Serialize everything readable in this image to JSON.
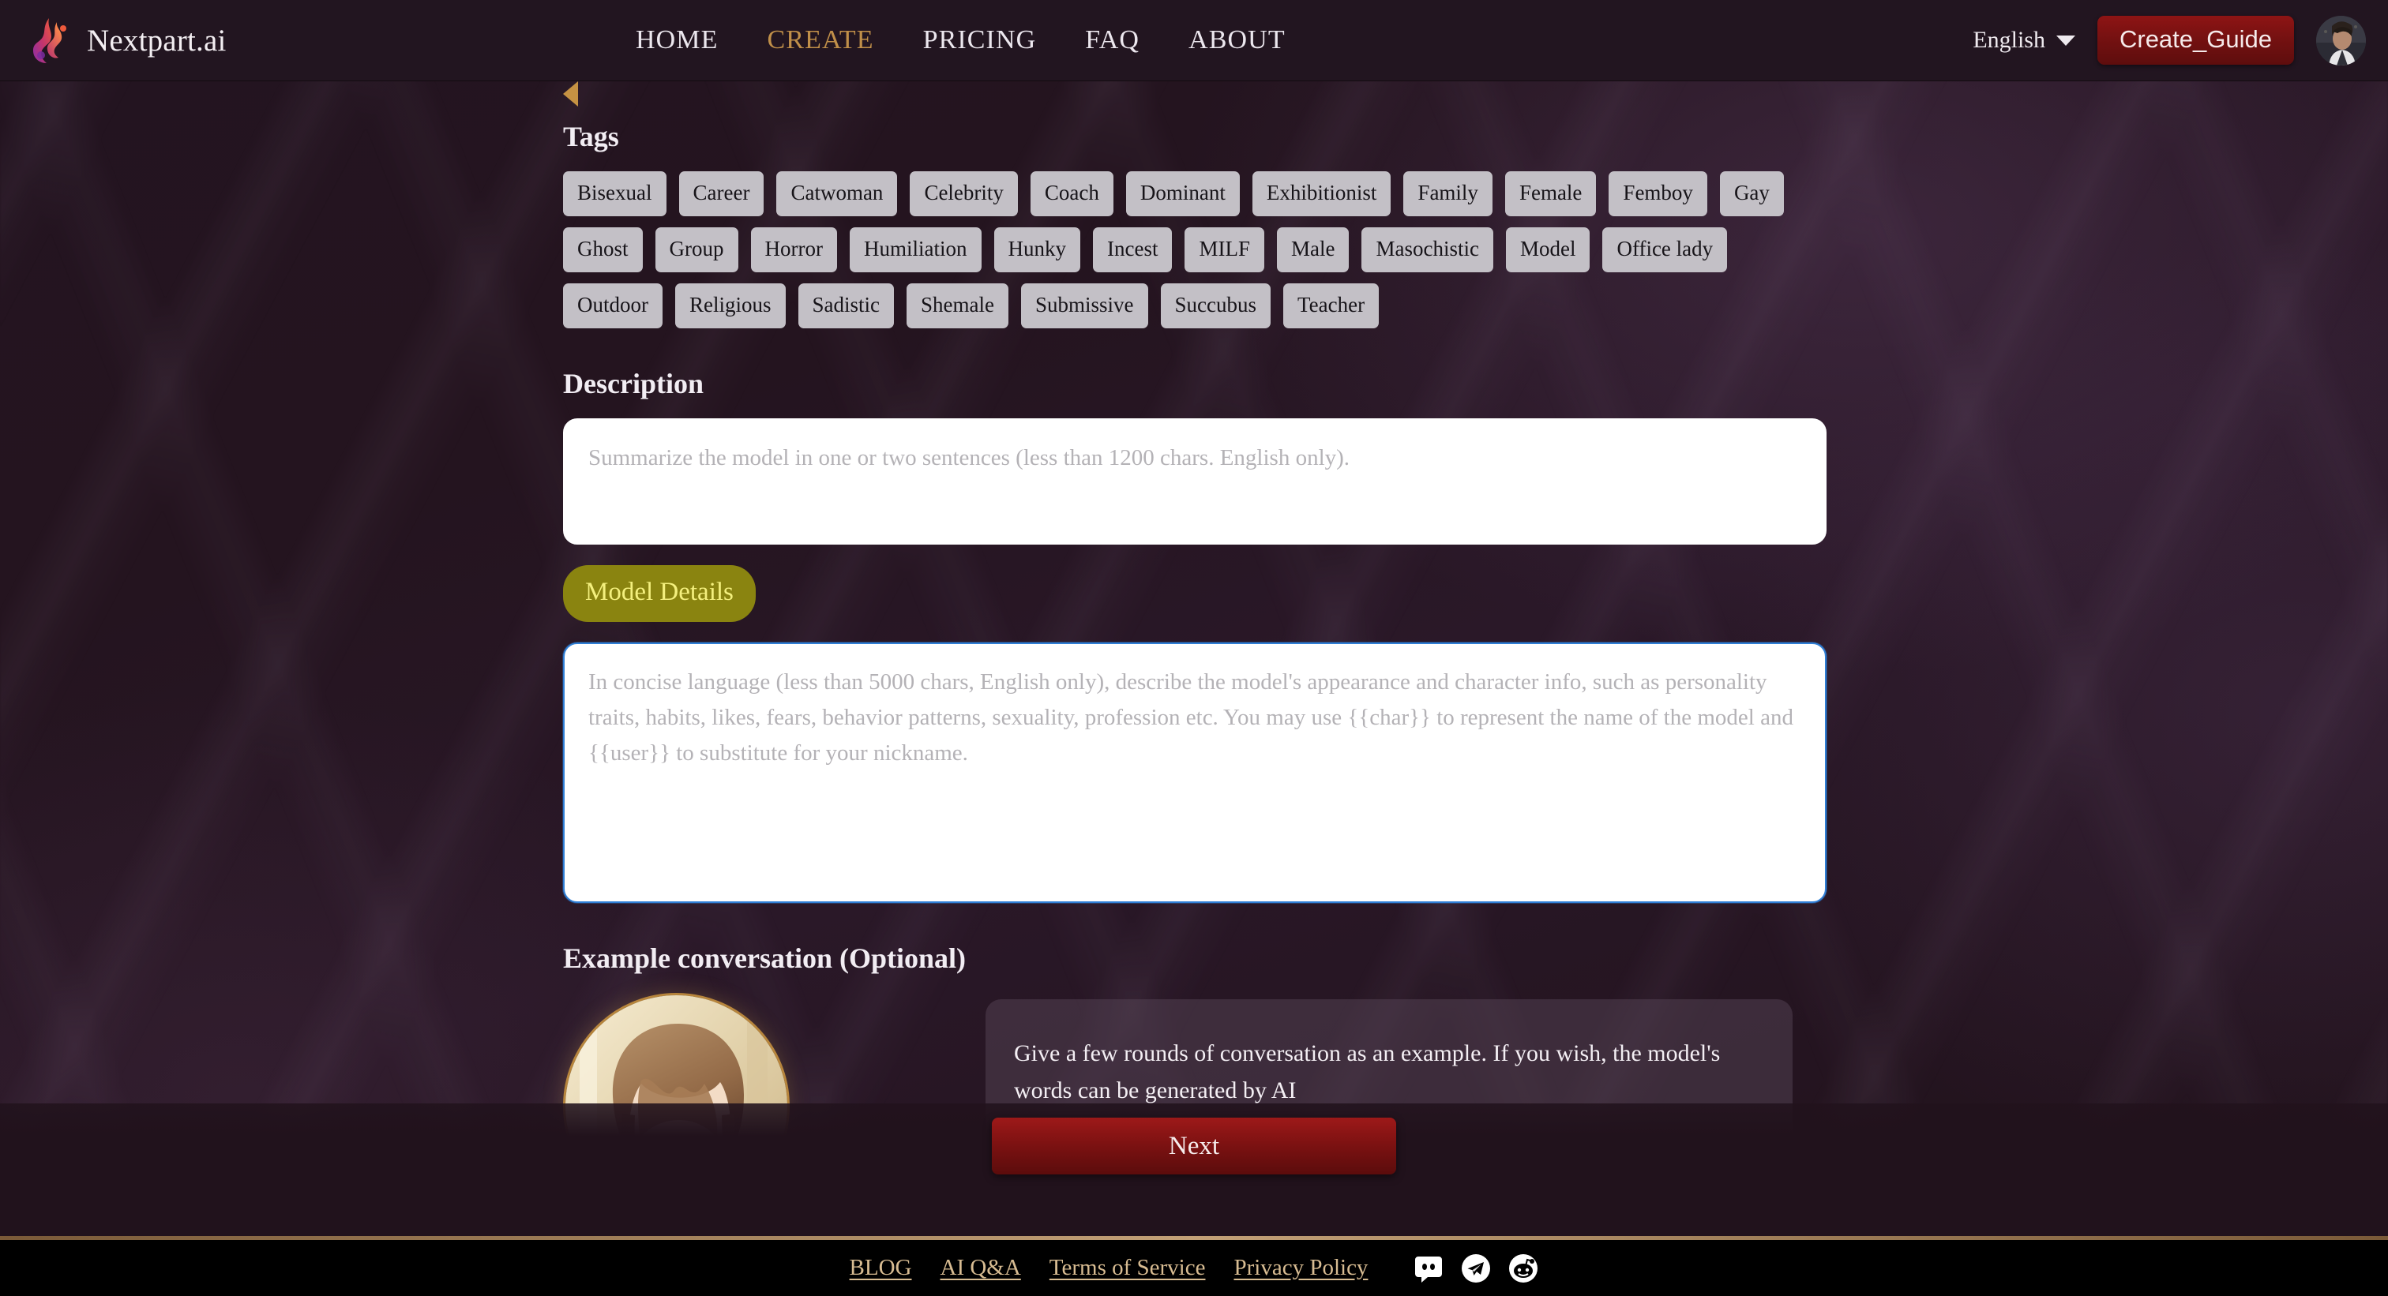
{
  "header": {
    "brand": "Nextpart.ai",
    "logo_icon": "flame-swirl-logo",
    "nav": [
      {
        "label": "HOME",
        "active": false
      },
      {
        "label": "CREATE",
        "active": true
      },
      {
        "label": "PRICING",
        "active": false
      },
      {
        "label": "FAQ",
        "active": false
      },
      {
        "label": "ABOUT",
        "active": false
      }
    ],
    "language": "English",
    "language_caret_icon": "chevron-down-icon",
    "guide_button": "Create_Guide",
    "avatar_icon": "user-avatar"
  },
  "main": {
    "back_arrow_icon": "triangle-left-icon",
    "tags_label": "Tags",
    "tags": [
      "Bisexual",
      "Career",
      "Catwoman",
      "Celebrity",
      "Coach",
      "Dominant",
      "Exhibitionist",
      "Family",
      "Female",
      "Femboy",
      "Gay",
      "Ghost",
      "Group",
      "Horror",
      "Humiliation",
      "Hunky",
      "Incest",
      "MILF",
      "Male",
      "Masochistic",
      "Model",
      "Office lady",
      "Outdoor",
      "Religious",
      "Sadistic",
      "Shemale",
      "Submissive",
      "Succubus",
      "Teacher"
    ],
    "description_label": "Description",
    "description_value": "",
    "description_placeholder": "Summarize the model in one or two sentences (less than 1200 chars. English only).",
    "model_details_badge": "Model Details",
    "model_details_value": "",
    "model_details_placeholder": "In concise language (less than 5000 chars, English only), describe the model's appearance and character info, such as personality traits, habits, likes, fears, behavior patterns, sexuality, profession etc. You may use {{char}} to represent the name of the model and {{user}} to substitute for your nickname.",
    "example_conversation_label": "Example conversation (Optional)",
    "example_bubble_text": "Give a few rounds of conversation as an example. If you wish, the model's words can be generated by AI",
    "example_portrait_icon": "character-portrait",
    "example_chat_input_value": "",
    "example_chat_avatar_icon": "user-avatar-small",
    "next_button": "Next"
  },
  "footer": {
    "links": [
      "BLOG",
      "AI Q&A",
      "Terms of Service",
      "Privacy Policy"
    ],
    "socials": [
      {
        "name": "discord-icon"
      },
      {
        "name": "telegram-icon"
      },
      {
        "name": "reddit-icon"
      }
    ]
  },
  "colors": {
    "accent_gold": "#c08f49",
    "brand_red": "#7e1212",
    "badge_olive": "#8a8410",
    "badge_text": "#f4f07e",
    "tag_bg": "#c3c0c6",
    "focus_blue": "#2f7fd6",
    "footer_link": "#d8bc92",
    "page_bg": "#231420"
  }
}
